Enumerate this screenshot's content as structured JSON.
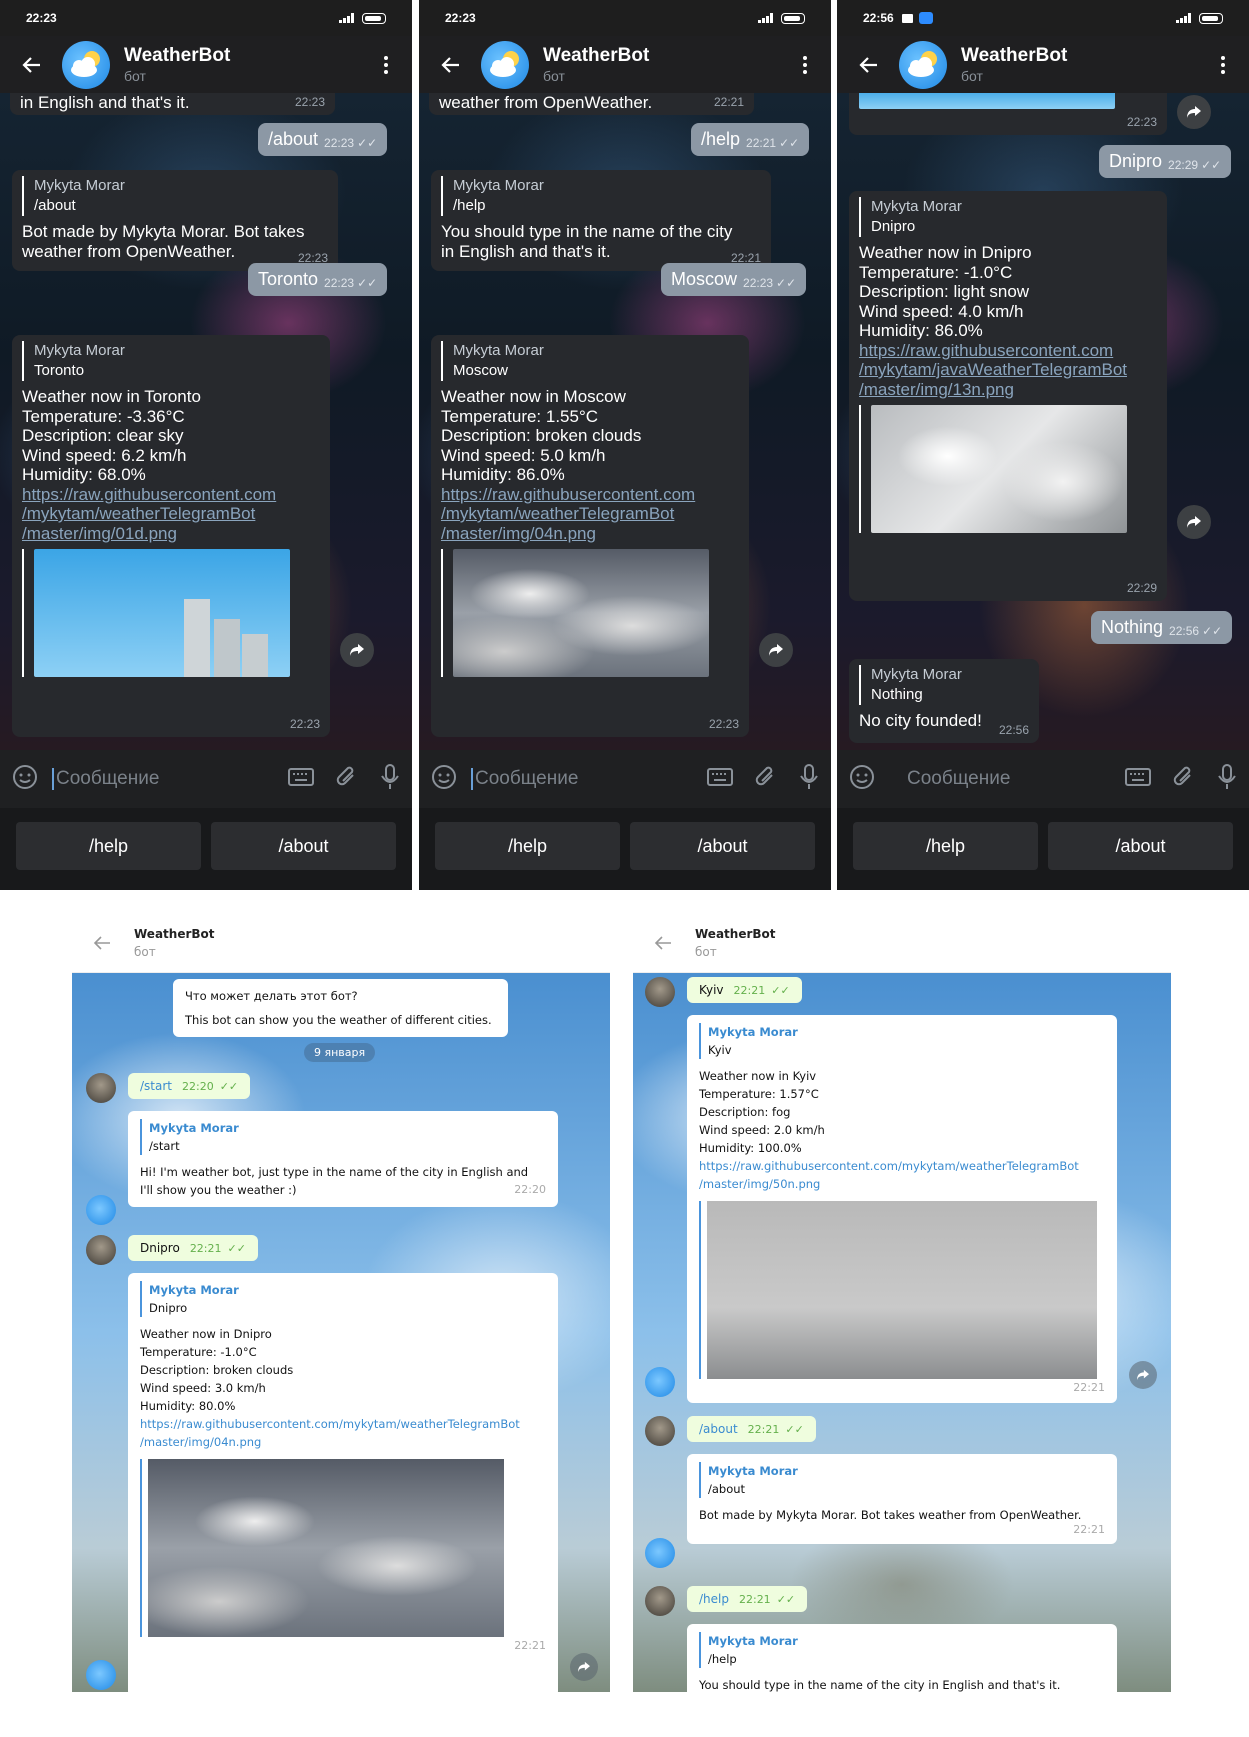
{
  "common": {
    "bot_title": "WeatherBot",
    "bot_subtitle": "бот",
    "input_placeholder": "Сообщение",
    "kb_help": "/help",
    "kb_about": "/about",
    "sender": "Mykyta Morar"
  },
  "phone1": {
    "status_time": "22:23",
    "top_text": "in English and that's it.",
    "top_time": "22:23",
    "out1": {
      "text": "/about",
      "time": "22:23"
    },
    "in1": {
      "reply": "/about",
      "text1": "Bot made by Mykyta Morar. Bot takes",
      "text2": "weather from OpenWeather.",
      "time": "22:23"
    },
    "out2": {
      "text": "Toronto",
      "time": "22:23"
    },
    "in2": {
      "reply": "Toronto",
      "lines": [
        "Weather now in Toronto",
        "Temperature:  -3.36°C",
        "Description: clear sky",
        "Wind speed: 6.2 km/h",
        "Humidity: 68.0%"
      ],
      "link": [
        "https://raw.githubusercontent.com",
        "/mykytam/weatherTelegramBot",
        "/master/img/01d.png"
      ],
      "time": "22:23"
    }
  },
  "phone2": {
    "status_time": "22:23",
    "top_text": "weather from OpenWeather.",
    "top_time": "22:21",
    "out1": {
      "text": "/help",
      "time": "22:21"
    },
    "in1": {
      "reply": "/help",
      "text1": "You should type in the name of the city",
      "text2": "in English and that's it.",
      "time": "22:21"
    },
    "out2": {
      "text": "Moscow",
      "time": "22:23"
    },
    "in2": {
      "reply": "Moscow",
      "lines": [
        "Weather now in Moscow",
        "Temperature:  1.55°C",
        "Description: broken clouds",
        "Wind speed: 5.0 km/h",
        "Humidity: 86.0%"
      ],
      "link": [
        "https://raw.githubusercontent.com",
        "/mykytam/weatherTelegramBot",
        "/master/img/04n.png"
      ],
      "time": "22:23"
    }
  },
  "phone3": {
    "status_time": "22:56",
    "top_time": "22:23",
    "out1": {
      "text": "Dnipro",
      "time": "22:29"
    },
    "in1": {
      "reply": "Dnipro",
      "lines": [
        "Weather now in Dnipro",
        "Temperature:  -1.0°C",
        "Description: light snow",
        "Wind speed: 4.0 km/h",
        "Humidity: 86.0%"
      ],
      "link": [
        "https://raw.githubusercontent.com",
        "/mykytam/javaWeatherTelegramBot",
        "/master/img/13n.png"
      ],
      "time": "22:29"
    },
    "out2": {
      "text": "Nothing",
      "time": "22:56"
    },
    "in2": {
      "reply": "Nothing",
      "text": "No city founded!",
      "time": "22:56"
    }
  },
  "desk1": {
    "intro_title": "Что может делать этот бот?",
    "intro_text": "This bot can show you the weather of different cities.",
    "date": "9 января",
    "out1": {
      "text": "/start",
      "time": "22:20"
    },
    "in1": {
      "reply": "/start",
      "text1": "Hi! I'm weather bot, just type in the name of the city in English and",
      "text2": "I'll show you the weather :)",
      "time": "22:20"
    },
    "out2": {
      "text": "Dnipro",
      "time": "22:21"
    },
    "in2": {
      "reply": "Dnipro",
      "lines": [
        "Weather now in Dnipro",
        "Temperature:  -1.0°C",
        "Description: broken clouds",
        "Wind speed: 3.0 km/h",
        "Humidity: 80.0%"
      ],
      "link": [
        "https://raw.githubusercontent.com/mykytam/weatherTelegramBot",
        "/master/img/04n.png"
      ],
      "time": "22:21"
    }
  },
  "desk2": {
    "out1": {
      "text": "Kyiv",
      "time": "22:21"
    },
    "in1": {
      "reply": "Kyiv",
      "lines": [
        "Weather now in Kyiv",
        "Temperature:  1.57°C",
        "Description: fog",
        "Wind speed: 2.0 km/h",
        "Humidity: 100.0%"
      ],
      "link": [
        "https://raw.githubusercontent.com/mykytam/weatherTelegramBot",
        "/master/img/50n.png"
      ],
      "time": "22:21"
    },
    "out2": {
      "text": "/about",
      "time": "22:21"
    },
    "in2": {
      "reply": "/about",
      "text": "Bot made by Mykyta Morar. Bot takes weather from OpenWeather.",
      "time": "22:21"
    },
    "out3": {
      "text": "/help",
      "time": "22:21"
    },
    "in3": {
      "reply": "/help",
      "text": "You should type in the name of the city in English and that's it."
    }
  },
  "icons": {
    "back": "back-arrow-icon",
    "menu": "more-vert-icon",
    "emoji": "emoji-icon",
    "keyboard": "keyboard-icon",
    "attach": "attach-icon",
    "mic": "microphone-icon",
    "share": "share-icon",
    "check": "double-check-icon"
  }
}
